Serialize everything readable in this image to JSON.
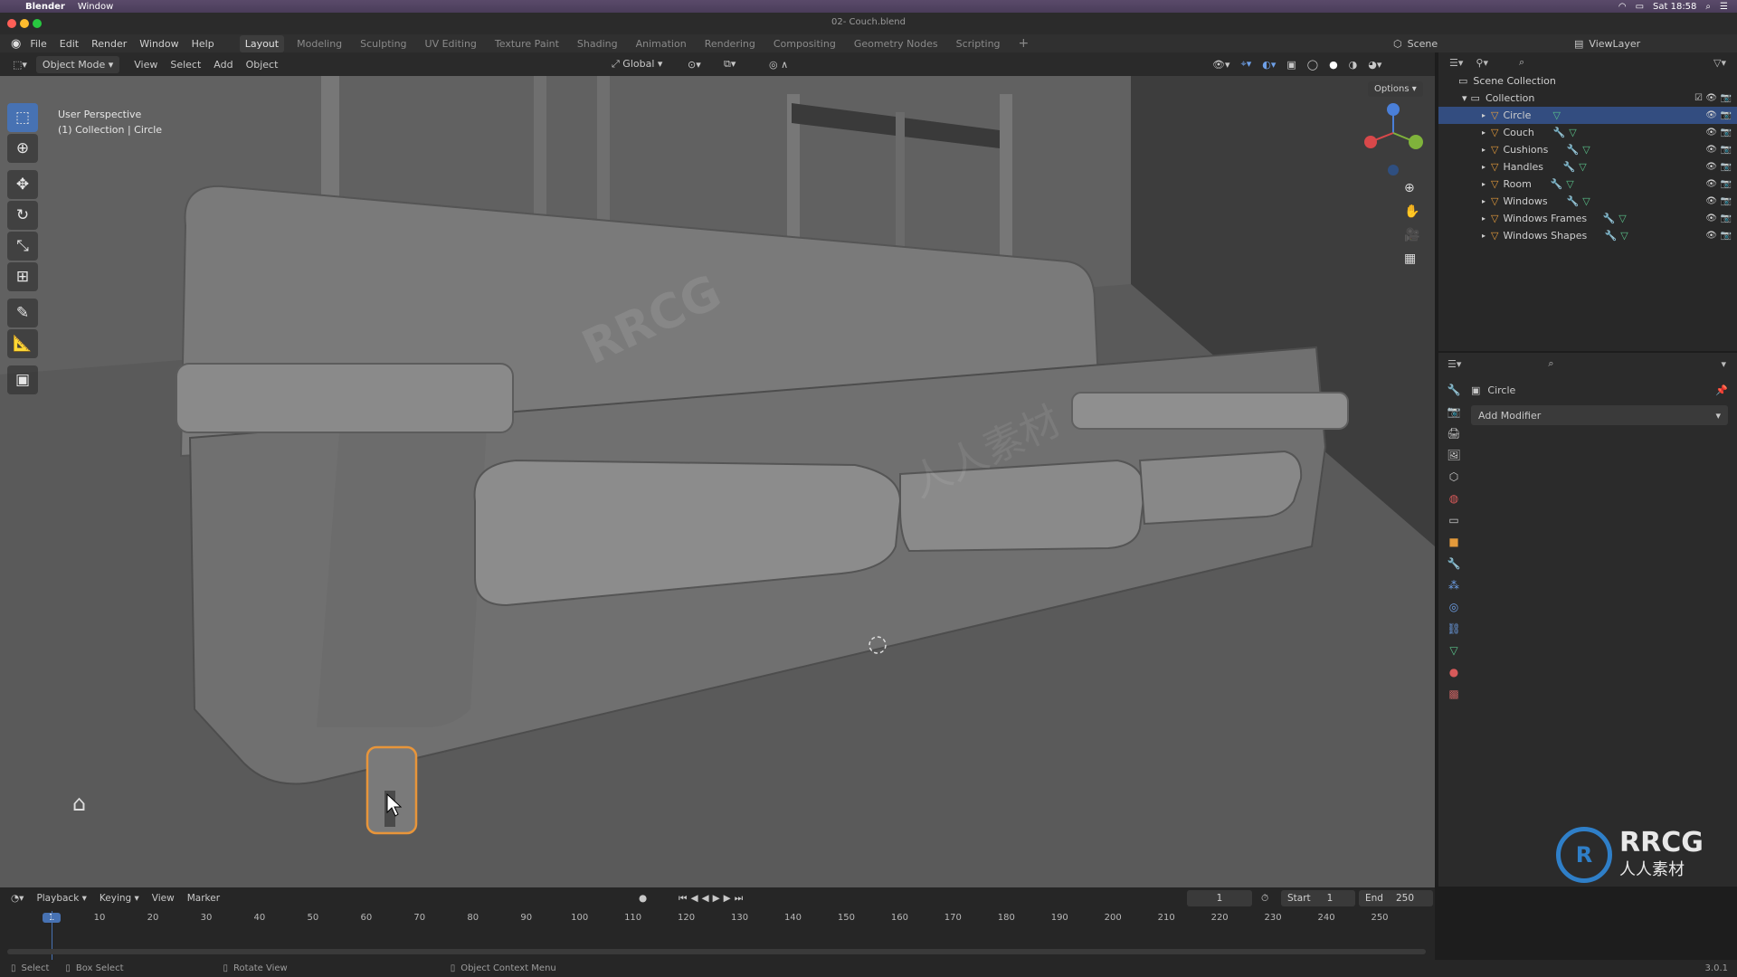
{
  "macbar": {
    "app": "Blender",
    "menu": "Window",
    "clock": "Sat 18:58"
  },
  "window": {
    "title": "02- Couch.blend"
  },
  "topmenu": {
    "items": [
      "File",
      "Edit",
      "Render",
      "Window",
      "Help"
    ],
    "workspaces": [
      "Layout",
      "Modeling",
      "Sculpting",
      "UV Editing",
      "Texture Paint",
      "Shading",
      "Animation",
      "Rendering",
      "Compositing",
      "Geometry Nodes",
      "Scripting"
    ],
    "active_workspace": "Layout",
    "scene_label": "Scene",
    "viewlayer_label": "ViewLayer"
  },
  "viewport_header": {
    "mode": "Object Mode",
    "menus": [
      "View",
      "Select",
      "Add",
      "Object"
    ],
    "orientation": "Global",
    "options": "Options"
  },
  "viewport": {
    "perspective": "User Perspective",
    "collection_info": "(1) Collection | Circle"
  },
  "outliner": {
    "scene_collection": "Scene Collection",
    "collection": "Collection",
    "objects": [
      "Circle",
      "Couch",
      "Cushions",
      "Handles",
      "Room",
      "Windows",
      "Windows Frames",
      "Windows Shapes"
    ],
    "selected": "Circle"
  },
  "properties": {
    "object_name": "Circle",
    "add_modifier": "Add Modifier"
  },
  "timeline": {
    "menus": [
      "Playback",
      "Keying",
      "View",
      "Marker"
    ],
    "current_frame": "1",
    "start_label": "Start",
    "start": "1",
    "end_label": "End",
    "end": "250",
    "ticks": [
      "1",
      "10",
      "20",
      "30",
      "40",
      "50",
      "60",
      "70",
      "80",
      "90",
      "100",
      "110",
      "120",
      "130",
      "140",
      "150",
      "160",
      "170",
      "180",
      "190",
      "200",
      "210",
      "220",
      "230",
      "240",
      "250"
    ]
  },
  "statusbar": {
    "select": "Select",
    "box_select": "Box Select",
    "rotate_view": "Rotate View",
    "context_menu": "Object Context Menu",
    "version": "3.0.1"
  },
  "watermark": {
    "logo": "RRCG",
    "subtitle": "人人素材"
  },
  "colors": {
    "accent": "#4772b3",
    "selection": "#334d80",
    "object_icon": "#e39a3b",
    "selected_outline": "#e8953a"
  }
}
